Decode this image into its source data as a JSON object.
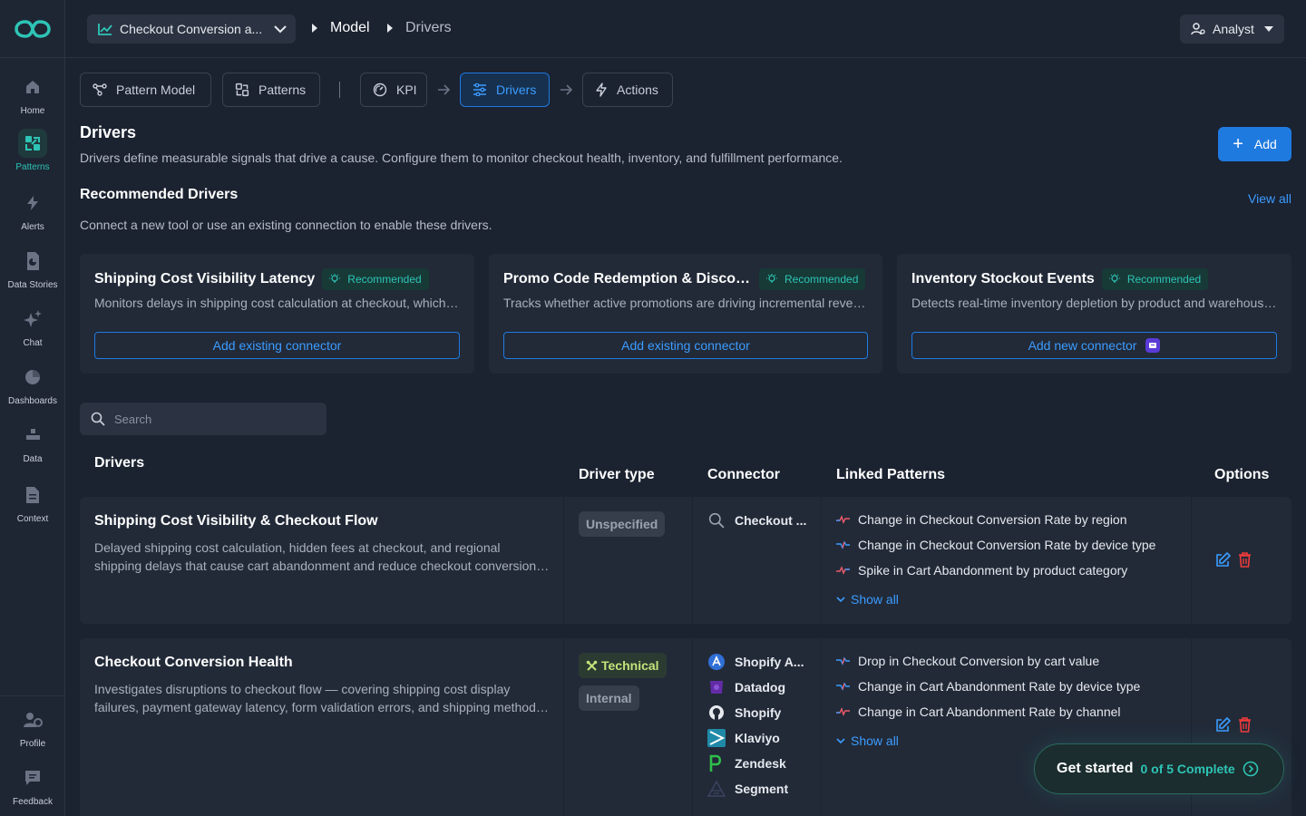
{
  "sidebar": {
    "items": [
      {
        "label": "Home",
        "icon": "home-icon"
      },
      {
        "label": "Patterns",
        "icon": "patterns-icon",
        "active": true
      },
      {
        "label": "Alerts",
        "icon": "lightning-icon"
      },
      {
        "label": "Data Stories",
        "icon": "data-stories-icon"
      },
      {
        "label": "Chat",
        "icon": "sparkles-icon"
      },
      {
        "label": "Dashboards",
        "icon": "pie-chart-icon"
      },
      {
        "label": "Data",
        "icon": "data-icon"
      },
      {
        "label": "Context",
        "icon": "document-icon"
      }
    ],
    "bottom": [
      {
        "label": "Profile",
        "icon": "profile-gear-icon"
      },
      {
        "label": "Feedback",
        "icon": "feedback-icon"
      }
    ]
  },
  "topbar": {
    "kpi_select": "Checkout Conversion a...",
    "breadcrumb": [
      "Model",
      "Drivers"
    ],
    "role": "Analyst"
  },
  "tabs": [
    "Pattern Model",
    "Patterns",
    "KPI",
    "Drivers",
    "Actions"
  ],
  "active_tab": "Drivers",
  "page": {
    "title": "Drivers",
    "description": "Drivers define measurable signals that drive a cause. Configure them to monitor checkout health, inventory, and fulfillment performance.",
    "add_label": "Add"
  },
  "recommended": {
    "title": "Recommended Drivers",
    "description": "Connect a new tool or use an existing connection to enable these drivers.",
    "view_all": "View all",
    "badge": "Recommended",
    "cards": [
      {
        "name": "Shipping Cost Visibility Latency",
        "desc": "Monitors delays in shipping cost calculation at checkout, which may cause cart abandonment",
        "button": "Add existing connector"
      },
      {
        "name": "Promo Code Redemption & Discount Impact",
        "desc": "Tracks whether active promotions are driving incremental revenue or eroding margin",
        "button": "Add existing connector"
      },
      {
        "name": "Inventory Stockout Events",
        "desc": "Detects real-time inventory depletion by product and warehouse location",
        "button": "Add new connector"
      }
    ]
  },
  "search": {
    "placeholder": "Search"
  },
  "table": {
    "headers": {
      "drivers": "Drivers",
      "type": "Driver type",
      "connector": "Connector",
      "patterns": "Linked Patterns",
      "options": "Options"
    },
    "show_all": "Show all",
    "rows": [
      {
        "title": "Shipping Cost Visibility & Checkout Flow",
        "desc_lines": [
          "Delayed shipping cost calculation, hidden fees at checkout, and regional",
          "shipping delays that cause cart abandonment and reduce checkout conversion rates"
        ],
        "types": [
          "Unspecified"
        ],
        "connectors": [
          "Checkout ..."
        ],
        "patterns": [
          "Change in Checkout Conversion Rate by region",
          "Change in Checkout Conversion Rate by device type",
          "Spike in Cart Abandonment by product category"
        ]
      },
      {
        "title": "Checkout Conversion Health",
        "desc_lines": [
          "Investigates disruptions to checkout flow — covering shipping cost display",
          "failures, payment gateway latency, form validation errors, and shipping method issues"
        ],
        "types": [
          "Technical",
          "Internal"
        ],
        "connectors": [
          "Shopify A...",
          "Datadog",
          "Shopify",
          "Klaviyo",
          "Zendesk",
          "Segment"
        ],
        "patterns": [
          "Drop in Checkout Conversion by cart value",
          "Change in Cart Abandonment Rate by device type",
          "Change in Cart Abandonment Rate by channel"
        ]
      }
    ]
  },
  "get_started": {
    "label": "Get started",
    "progress": "0 of 5 Complete"
  },
  "colors": {
    "accent_blue": "#1f7ae0",
    "accent_teal": "#2ec4b6",
    "background": "#1b2230",
    "card": "#222a38"
  }
}
